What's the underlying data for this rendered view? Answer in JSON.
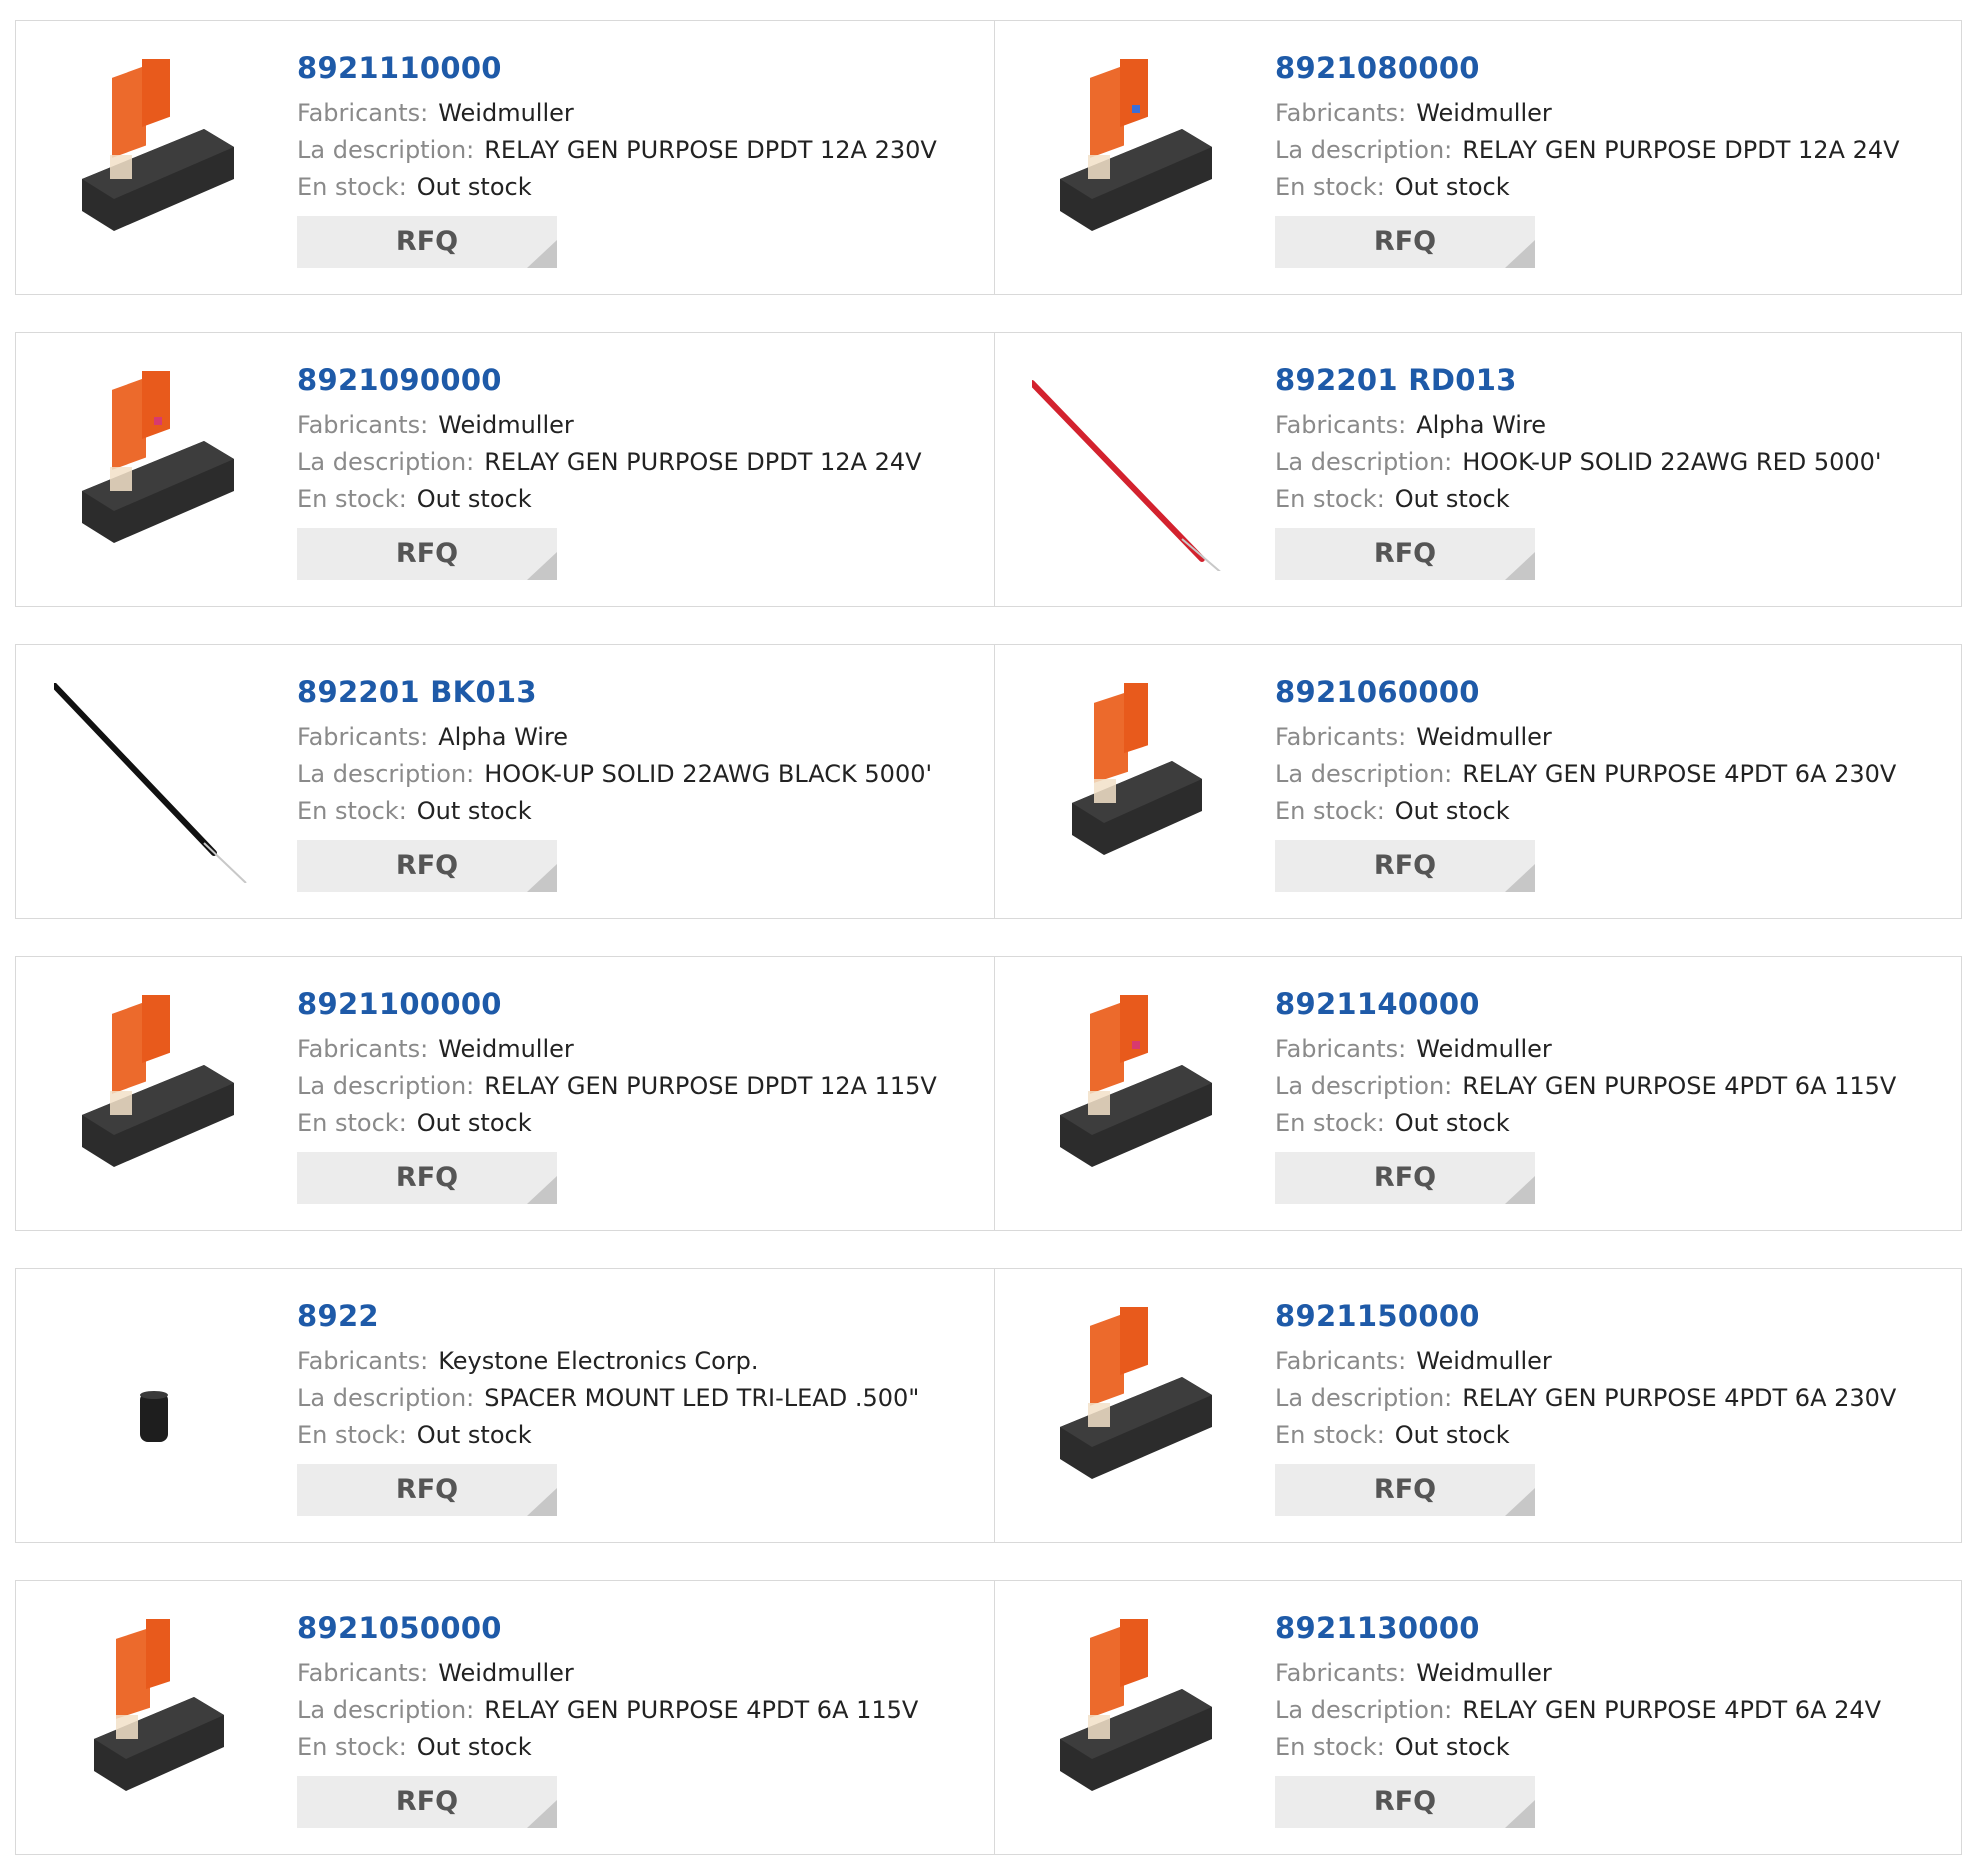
{
  "labels": {
    "manufacturer": "Fabricants:",
    "description": "La description:",
    "stock": "En stock:",
    "rfq": "RFQ"
  },
  "colors": {
    "link": "#1e5aa8",
    "label": "#8a8a8a",
    "button_bg": "#ececec"
  },
  "products": [
    {
      "part": "8921110000",
      "manufacturer": "Weidmuller",
      "description": "RELAY GEN PURPOSE DPDT 12A 230V",
      "stock": "Out stock",
      "image": "relay-icon"
    },
    {
      "part": "8921080000",
      "manufacturer": "Weidmuller",
      "description": "RELAY GEN PURPOSE DPDT 12A 24V",
      "stock": "Out stock",
      "image": "relay-icon"
    },
    {
      "part": "8921090000",
      "manufacturer": "Weidmuller",
      "description": "RELAY GEN PURPOSE DPDT 12A 24V",
      "stock": "Out stock",
      "image": "relay-icon"
    },
    {
      "part": "892201 RD013",
      "manufacturer": "Alpha Wire",
      "description": "HOOK-UP SOLID 22AWG RED 5000'",
      "stock": "Out stock",
      "image": "red-wire-icon"
    },
    {
      "part": "892201 BK013",
      "manufacturer": "Alpha Wire",
      "description": "HOOK-UP SOLID 22AWG BLACK 5000'",
      "stock": "Out stock",
      "image": "black-wire-icon"
    },
    {
      "part": "8921060000",
      "manufacturer": "Weidmuller",
      "description": "RELAY GEN PURPOSE 4PDT 6A 230V",
      "stock": "Out stock",
      "image": "relay-icon"
    },
    {
      "part": "8921100000",
      "manufacturer": "Weidmuller",
      "description": "RELAY GEN PURPOSE DPDT 12A 115V",
      "stock": "Out stock",
      "image": "relay-icon"
    },
    {
      "part": "8921140000",
      "manufacturer": "Weidmuller",
      "description": "RELAY GEN PURPOSE 4PDT 6A 115V",
      "stock": "Out stock",
      "image": "relay-icon"
    },
    {
      "part": "8922",
      "manufacturer": "Keystone Electronics Corp.",
      "description": "SPACER MOUNT LED TRI-LEAD .500\"",
      "stock": "Out stock",
      "image": "spacer-icon"
    },
    {
      "part": "8921150000",
      "manufacturer": "Weidmuller",
      "description": "RELAY GEN PURPOSE 4PDT 6A 230V",
      "stock": "Out stock",
      "image": "relay-icon"
    },
    {
      "part": "8921050000",
      "manufacturer": "Weidmuller",
      "description": "RELAY GEN PURPOSE 4PDT 6A 115V",
      "stock": "Out stock",
      "image": "relay-icon"
    },
    {
      "part": "8921130000",
      "manufacturer": "Weidmuller",
      "description": "RELAY GEN PURPOSE 4PDT 6A 24V",
      "stock": "Out stock",
      "image": "relay-icon"
    }
  ]
}
